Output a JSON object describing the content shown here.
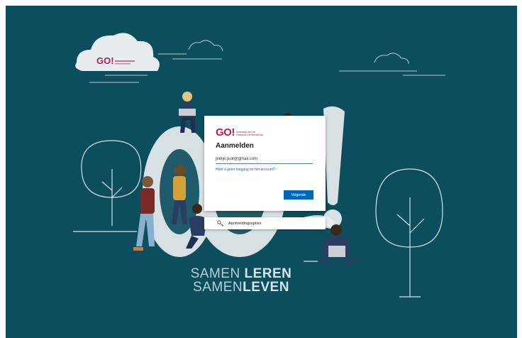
{
  "brand": {
    "logo_text": "GO!",
    "logo_subtitle": "onderwijs van de Vlaamse Gemeenschap"
  },
  "tagline": {
    "line1_light": "SAMEN ",
    "line1_bold": "LEREN",
    "line2_light": "SAMEN",
    "line2_bold": "LEVEN"
  },
  "signin": {
    "title": "Aanmelden",
    "email_value": "pietje.puk@gmail.com",
    "no_access_link": "Hebt u geen toegang tot het account?",
    "next_button": "Volgende"
  },
  "signin_options": {
    "label": "Aanmeldingsopties",
    "icon": "key-icon"
  },
  "colors": {
    "background": "#0c4d5e",
    "brand": "#b4205d",
    "link": "#0067b8",
    "button": "#0067b8"
  }
}
